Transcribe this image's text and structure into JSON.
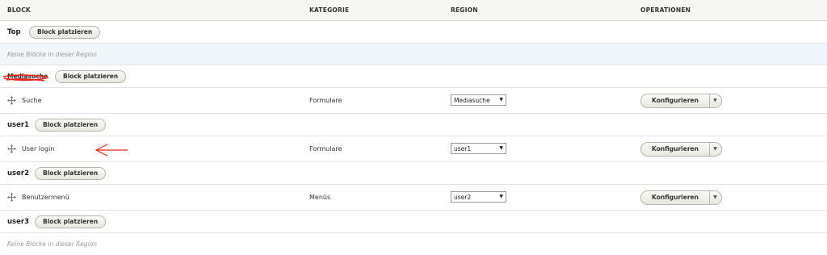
{
  "columns": {
    "block": "BLOCK",
    "category": "KATEGORIE",
    "region": "REGION",
    "operations": "OPERATIONEN"
  },
  "place_label": "Block platzieren",
  "empty_label": "Keine Blöcke in dieser Region",
  "regions": [
    {
      "name": "Top"
    },
    {
      "name": "Mediasuche"
    },
    {
      "name": "user1"
    },
    {
      "name": "user2"
    },
    {
      "name": "user3"
    }
  ],
  "blocks": [
    {
      "name": "Suche",
      "category": "Formulare",
      "region": "Mediasuche",
      "operation": "Konfigurieren"
    },
    {
      "name": "User login",
      "category": "Formulare",
      "region": "user1",
      "operation": "Konfigurieren"
    },
    {
      "name": "Benutzermenü",
      "category": "Menüs",
      "region": "user2",
      "operation": "Konfigurieren"
    }
  ],
  "icons": {
    "drag": "move-cross-icon",
    "dropdown": "caret-down-icon"
  },
  "colors": {
    "annotation": "#e8231b",
    "empty_row_bg": "#f0f6fa",
    "header_bg": "#f6f6f2"
  }
}
